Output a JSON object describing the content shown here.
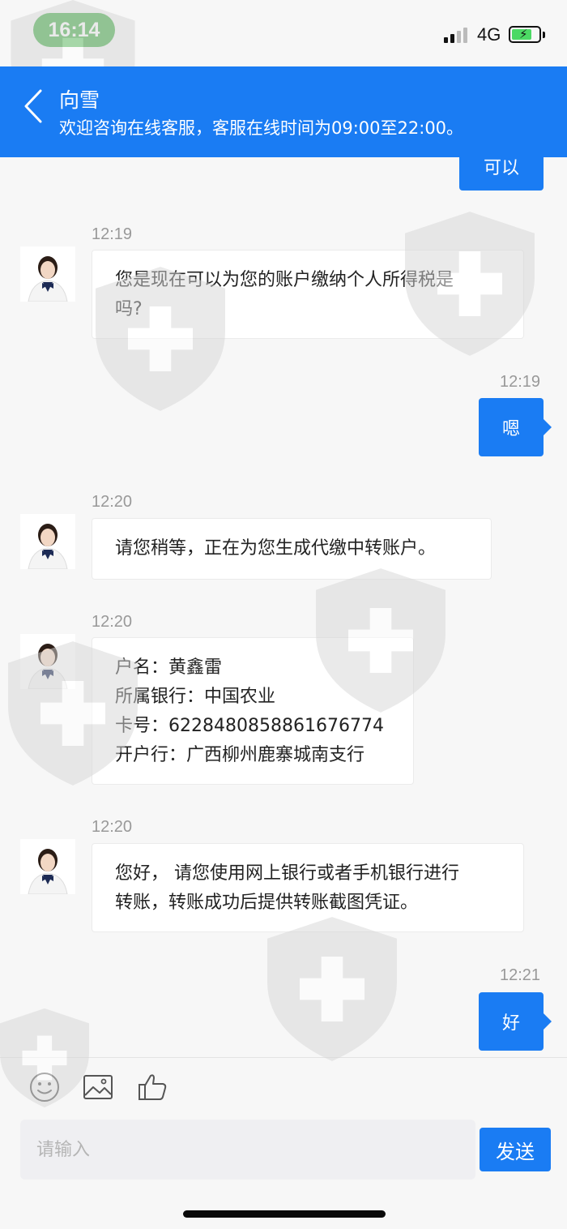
{
  "status_bar": {
    "time": "16:14",
    "network": "4G"
  },
  "header": {
    "agent_name": "向雪",
    "service_hours": "欢迎咨询在线客服，客服在线时间为09:00至22:00。"
  },
  "messages": [
    {
      "side": "out",
      "text": "可以"
    },
    {
      "side": "in",
      "time": "12:19",
      "lines": [
        "您是现在可以为您的账户缴纳个人所得税是",
        "吗?"
      ]
    },
    {
      "side": "out",
      "time": "12:19",
      "text": "嗯"
    },
    {
      "side": "in",
      "time": "12:20",
      "lines": [
        "请您稍等，正在为您生成代缴中转账户。"
      ]
    },
    {
      "side": "in",
      "time": "12:20",
      "lines": [
        "户名：黄鑫雷",
        "所属银行：中国农业",
        "卡号：6228480858861676774",
        "开户行：广西柳州鹿寨城南支行"
      ]
    },
    {
      "side": "in",
      "time": "12:20",
      "lines": [
        "您好， 请您使用网上银行或者手机银行进行",
        "转账，转账成功后提供转账截图凭证。"
      ]
    },
    {
      "side": "out",
      "time": "12:21",
      "text": "好"
    }
  ],
  "input": {
    "placeholder": "请输入",
    "send_label": "发送"
  },
  "icons": {
    "back": "chevron-left-icon",
    "emoji": "smiley-icon",
    "image": "image-icon",
    "like": "thumbs-up-icon"
  },
  "colors": {
    "primary": "#1a7cf3",
    "time_pill": "#4cb050"
  }
}
